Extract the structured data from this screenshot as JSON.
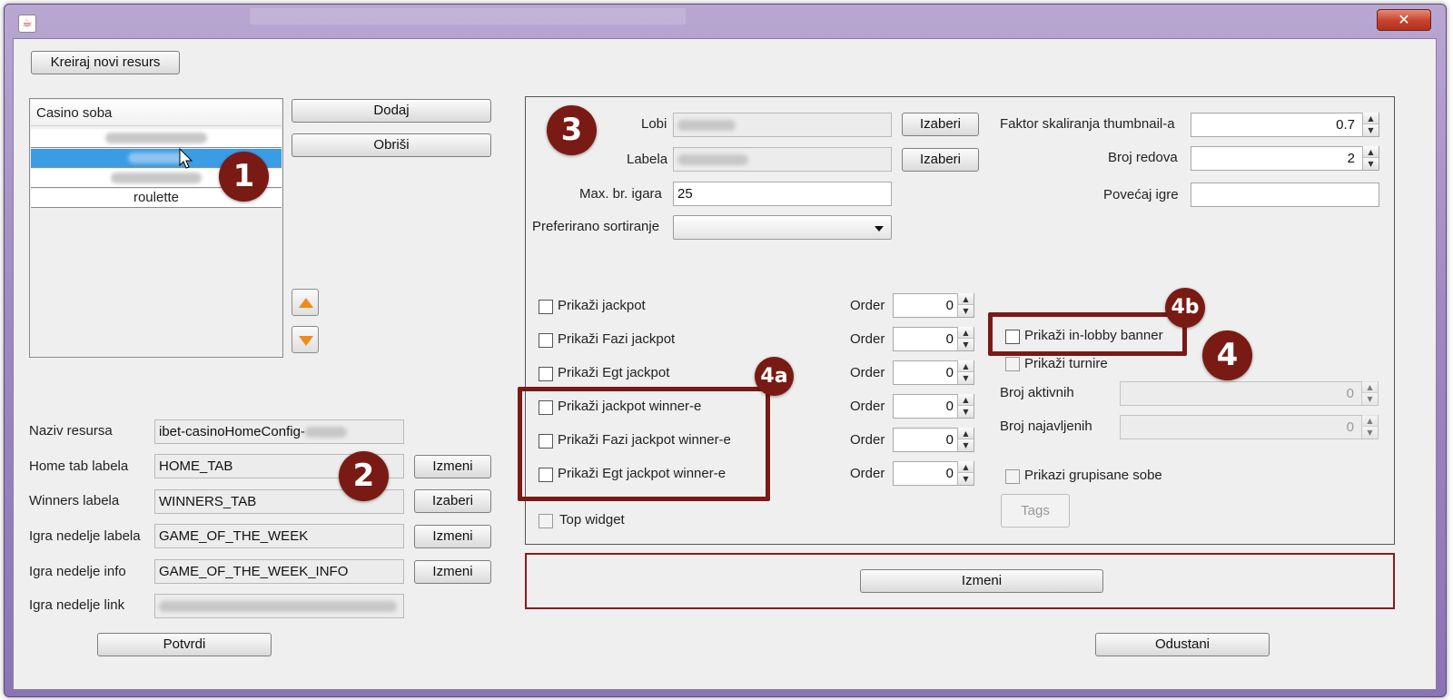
{
  "window": {
    "close_label": "✕",
    "app_icon": "java-icon"
  },
  "left": {
    "create_button": "Kreiraj novi resurs",
    "list": {
      "header": "Casino soba",
      "items": [
        "",
        "",
        "",
        "roulette"
      ],
      "selected_index": 1
    },
    "add_button": "Dodaj",
    "delete_button": "Obriši",
    "move_up_icon": "arrow-up-icon",
    "move_down_icon": "arrow-down-icon",
    "form": {
      "naziv_label": "Naziv resursa",
      "naziv_value": "ibet-casinoHomeConfig-",
      "home_tab_label": "Home tab labela",
      "home_tab_value": "HOME_TAB",
      "home_tab_button": "Izmeni",
      "winners_label": "Winners labela",
      "winners_value": "WINNERS_TAB",
      "winners_button": "Izaberi",
      "igra_nedelje_label": "Igra nedelje labela",
      "igra_nedelje_value": "GAME_OF_THE_WEEK",
      "igra_nedelje_button": "Izmeni",
      "igra_info_label": "Igra nedelje info",
      "igra_info_value": "GAME_OF_THE_WEEK_INFO",
      "igra_info_button": "Izmeni",
      "igra_link_label": "Igra nedelje link",
      "igra_link_value": ""
    },
    "confirm_button": "Potvrdi"
  },
  "right": {
    "lobi_label": "Lobi",
    "lobi_value": "",
    "lobi_button": "Izaberi",
    "labela_label": "Labela",
    "labela_value": "",
    "labela_button": "Izaberi",
    "max_igara_label": "Max. br. igara",
    "max_igara_value": "25",
    "sort_label": "Preferirano sortiranje",
    "sort_value": "",
    "faktor_label": "Faktor skaliranja thumbnail-a",
    "faktor_value": "0.7",
    "broj_redova_label": "Broj redova",
    "broj_redova_value": "2",
    "povecaj_label": "Povećaj igre",
    "povecaj_value": "",
    "checkboxes": [
      {
        "label": "Prikaži jackpot",
        "order_label": "Order",
        "order": "0"
      },
      {
        "label": "Prikaži Fazi jackpot",
        "order_label": "Order",
        "order": "0"
      },
      {
        "label": "Prikaži Egt jackpot",
        "order_label": "Order",
        "order": "0"
      },
      {
        "label": "Prikaži jackpot winner-e",
        "order_label": "Order",
        "order": "0"
      },
      {
        "label": "Prikaži Fazi jackpot winner-e",
        "order_label": "Order",
        "order": "0"
      },
      {
        "label": "Prikaži Egt jackpot winner-e",
        "order_label": "Order",
        "order": "0"
      }
    ],
    "top_widget_label": "Top widget",
    "in_lobby_label": "Prikaži in-lobby banner",
    "turniri_label": "Prikaži turnire",
    "broj_aktivnih_label": "Broj aktivnih",
    "broj_aktivnih_value": "0",
    "broj_najavljenih_label": "Broj najavljenih",
    "broj_najavljenih_value": "0",
    "grupisane_label": "Prikazi grupisane sobe",
    "tags_button": "Tags",
    "izmeni_button": "Izmeni",
    "cancel_button": "Odustani"
  },
  "badges": {
    "b1": "1",
    "b2": "2",
    "b3": "3",
    "b4": "4",
    "b4a": "4a",
    "b4b": "4b"
  },
  "colors": {
    "accent_red": "#7a1a14",
    "selection_blue": "#3a9ce4",
    "arrow_orange": "#f08a1b"
  }
}
